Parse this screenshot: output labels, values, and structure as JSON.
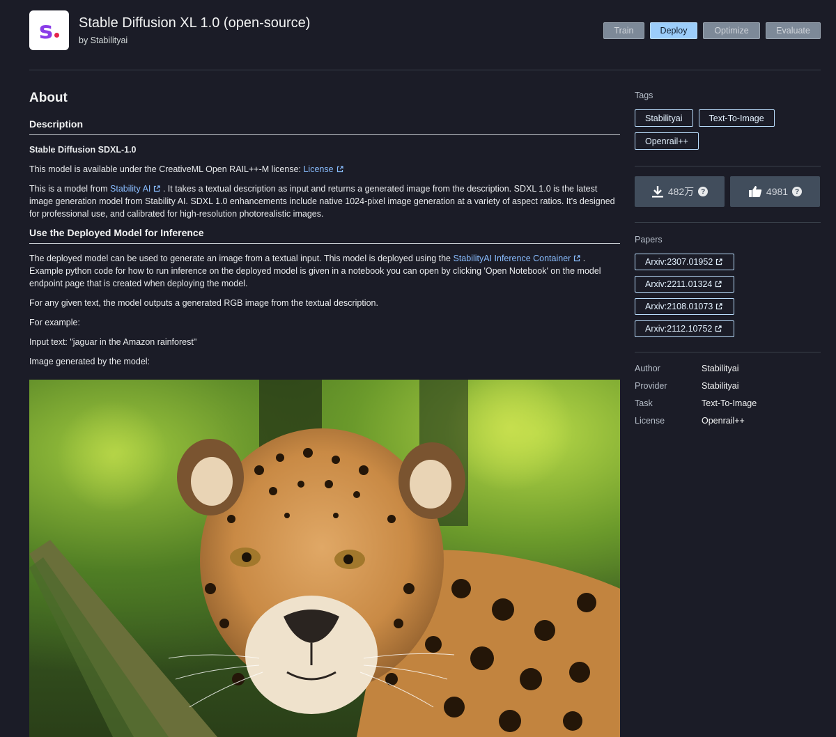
{
  "header": {
    "logo_letter": "s",
    "title": "Stable Diffusion XL 1.0 (open-source)",
    "byline": "by Stabilityai",
    "actions": {
      "train": "Train",
      "deploy": "Deploy",
      "optimize": "Optimize",
      "evaluate": "Evaluate"
    }
  },
  "main": {
    "about_heading": "About",
    "description_heading": "Description",
    "model_name": "Stable Diffusion SDXL-1.0",
    "license_text": "This model is available under the CreativeML Open RAIL++-M license: ",
    "license_link": "License",
    "model_from_prefix": "This is a model from ",
    "model_from_link": "Stability AI",
    "model_from_rest": " . It takes a textual description as input and returns a generated image from the description. SDXL 1.0 is the latest image generation model from Stability AI. SDXL 1.0 enhancements include native 1024-pixel image generation at a variety of aspect ratios. It's designed for professional use, and calibrated for high-resolution photorealistic images.",
    "inference_heading": "Use the Deployed Model for Inference",
    "inference_prefix": "The deployed model can be used to generate an image from a textual input. This model is deployed using the ",
    "inference_link": "StabilityAI Inference Container",
    "inference_rest": " . Example python code for how to run inference on the deployed model is given in a notebook you can open by clicking 'Open Notebook' on the model endpoint page that is created when deploying the model.",
    "output_text": "For any given text, the model outputs a generated RGB image from the textual description.",
    "example_label": "For example:",
    "input_text": "Input text: \"jaguar in the Amazon rainforest\"",
    "generated_label": "Image generated by the model:"
  },
  "sidebar": {
    "tags_label": "Tags",
    "tags": [
      "Stabilityai",
      "Text-To-Image",
      "Openrail++"
    ],
    "downloads": "482万",
    "likes": "4981",
    "help_glyph": "?",
    "papers_label": "Papers",
    "papers": [
      "Arxiv:2307.01952",
      "Arxiv:2211.01324",
      "Arxiv:2108.01073",
      "Arxiv:2112.10752"
    ],
    "meta": [
      {
        "key": "Author",
        "value": "Stabilityai"
      },
      {
        "key": "Provider",
        "value": "Stabilityai"
      },
      {
        "key": "Task",
        "value": "Text-To-Image"
      },
      {
        "key": "License",
        "value": "Openrail++"
      }
    ]
  },
  "colors": {
    "background": "#1b1c27",
    "link": "#89bdff",
    "primary_button": "#9ccdfa",
    "logo_purple": "#8a3ce8",
    "logo_red": "#e5234a"
  }
}
